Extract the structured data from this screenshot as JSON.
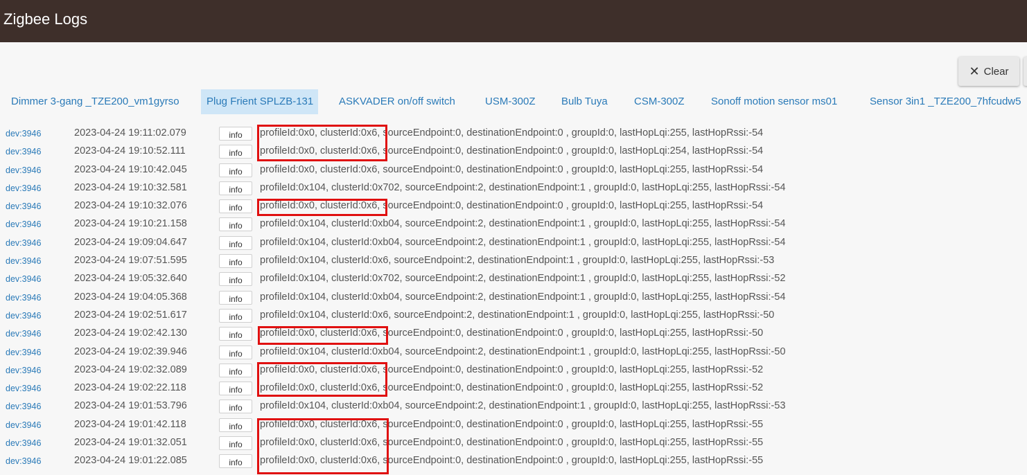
{
  "header": {
    "title": "Zigbee Logs",
    "background": "#3e2f2a"
  },
  "toolbar": {
    "clear_label": "Clear",
    "clear_icon": "close-icon"
  },
  "tabs": [
    {
      "label": "Dimmer 3-gang _TZE200_vm1gyrso",
      "active": false
    },
    {
      "label": "Plug Frient SPLZB-131",
      "active": true
    },
    {
      "label": "ASKVADER on/off switch",
      "active": false
    },
    {
      "label": "USM-300Z",
      "active": false
    },
    {
      "label": "Bulb Tuya",
      "active": false
    },
    {
      "label": "CSM-300Z",
      "active": false
    },
    {
      "label": "Sonoff motion sensor ms01",
      "active": false
    },
    {
      "label": "Sensor 3in1 _TZE200_7hfcudw5",
      "active": false
    }
  ],
  "logs": [
    {
      "dev": "dev:3946",
      "time": "2023-04-24 19:11:02.079",
      "level": "info",
      "msg": "profileId:0x0, clusterId:0x6, sourceEndpoint:0, destinationEndpoint:0 , groupId:0, lastHopLqi:255, lastHopRssi:-54"
    },
    {
      "dev": "dev:3946",
      "time": "2023-04-24 19:10:52.111",
      "level": "info",
      "msg": "profileId:0x0, clusterId:0x6, sourceEndpoint:0, destinationEndpoint:0 , groupId:0, lastHopLqi:254, lastHopRssi:-54"
    },
    {
      "dev": "dev:3946",
      "time": "2023-04-24 19:10:42.045",
      "level": "info",
      "msg": "profileId:0x0, clusterId:0x6, sourceEndpoint:0, destinationEndpoint:0 , groupId:0, lastHopLqi:255, lastHopRssi:-54"
    },
    {
      "dev": "dev:3946",
      "time": "2023-04-24 19:10:32.581",
      "level": "info",
      "msg": "profileId:0x104, clusterId:0x702, sourceEndpoint:2, destinationEndpoint:1 , groupId:0, lastHopLqi:255, lastHopRssi:-54"
    },
    {
      "dev": "dev:3946",
      "time": "2023-04-24 19:10:32.076",
      "level": "info",
      "msg": "profileId:0x0, clusterId:0x6, sourceEndpoint:0, destinationEndpoint:0 , groupId:0, lastHopLqi:255, lastHopRssi:-54"
    },
    {
      "dev": "dev:3946",
      "time": "2023-04-24 19:10:21.158",
      "level": "info",
      "msg": "profileId:0x104, clusterId:0xb04, sourceEndpoint:2, destinationEndpoint:1 , groupId:0, lastHopLqi:255, lastHopRssi:-54"
    },
    {
      "dev": "dev:3946",
      "time": "2023-04-24 19:09:04.647",
      "level": "info",
      "msg": "profileId:0x104, clusterId:0xb04, sourceEndpoint:2, destinationEndpoint:1 , groupId:0, lastHopLqi:255, lastHopRssi:-54"
    },
    {
      "dev": "dev:3946",
      "time": "2023-04-24 19:07:51.595",
      "level": "info",
      "msg": "profileId:0x104, clusterId:0x6, sourceEndpoint:2, destinationEndpoint:1 , groupId:0, lastHopLqi:255, lastHopRssi:-53"
    },
    {
      "dev": "dev:3946",
      "time": "2023-04-24 19:05:32.640",
      "level": "info",
      "msg": "profileId:0x104, clusterId:0x702, sourceEndpoint:2, destinationEndpoint:1 , groupId:0, lastHopLqi:255, lastHopRssi:-52"
    },
    {
      "dev": "dev:3946",
      "time": "2023-04-24 19:04:05.368",
      "level": "info",
      "msg": "profileId:0x104, clusterId:0xb04, sourceEndpoint:2, destinationEndpoint:1 , groupId:0, lastHopLqi:255, lastHopRssi:-54"
    },
    {
      "dev": "dev:3946",
      "time": "2023-04-24 19:02:51.617",
      "level": "info",
      "msg": "profileId:0x104, clusterId:0x6, sourceEndpoint:2, destinationEndpoint:1 , groupId:0, lastHopLqi:255, lastHopRssi:-50"
    },
    {
      "dev": "dev:3946",
      "time": "2023-04-24 19:02:42.130",
      "level": "info",
      "msg": "profileId:0x0, clusterId:0x6, sourceEndpoint:0, destinationEndpoint:0 , groupId:0, lastHopLqi:255, lastHopRssi:-50"
    },
    {
      "dev": "dev:3946",
      "time": "2023-04-24 19:02:39.946",
      "level": "info",
      "msg": "profileId:0x104, clusterId:0xb04, sourceEndpoint:2, destinationEndpoint:1 , groupId:0, lastHopLqi:255, lastHopRssi:-50"
    },
    {
      "dev": "dev:3946",
      "time": "2023-04-24 19:02:32.089",
      "level": "info",
      "msg": "profileId:0x0, clusterId:0x6, sourceEndpoint:0, destinationEndpoint:0 , groupId:0, lastHopLqi:255, lastHopRssi:-52"
    },
    {
      "dev": "dev:3946",
      "time": "2023-04-24 19:02:22.118",
      "level": "info",
      "msg": "profileId:0x0, clusterId:0x6, sourceEndpoint:0, destinationEndpoint:0 , groupId:0, lastHopLqi:255, lastHopRssi:-52"
    },
    {
      "dev": "dev:3946",
      "time": "2023-04-24 19:01:53.796",
      "level": "info",
      "msg": "profileId:0x104, clusterId:0xb04, sourceEndpoint:2, destinationEndpoint:1 , groupId:0, lastHopLqi:255, lastHopRssi:-53"
    },
    {
      "dev": "dev:3946",
      "time": "2023-04-24 19:01:42.118",
      "level": "info",
      "msg": "profileId:0x0, clusterId:0x6, sourceEndpoint:0, destinationEndpoint:0 , groupId:0, lastHopLqi:255, lastHopRssi:-55"
    },
    {
      "dev": "dev:3946",
      "time": "2023-04-24 19:01:32.051",
      "level": "info",
      "msg": "profileId:0x0, clusterId:0x6, sourceEndpoint:0, destinationEndpoint:0 , groupId:0, lastHopLqi:255, lastHopRssi:-55"
    },
    {
      "dev": "dev:3946",
      "time": "2023-04-24 19:01:22.085",
      "level": "info",
      "msg": "profileId:0x0, clusterId:0x6, sourceEndpoint:0, destinationEndpoint:0 , groupId:0, lastHopLqi:255, lastHopRssi:-55"
    }
  ],
  "annotation_color": "#e01010"
}
